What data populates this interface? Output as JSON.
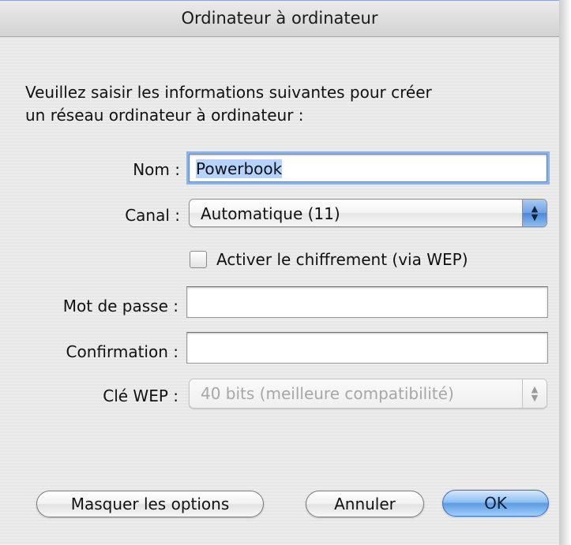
{
  "window": {
    "title": "Ordinateur à ordinateur"
  },
  "intro": {
    "line1": "Veuillez saisir les informations suivantes pour créer",
    "line2": "un réseau ordinateur à ordinateur :"
  },
  "form": {
    "name_label": "Nom :",
    "name_value": "Powerbook",
    "channel_label": "Canal :",
    "channel_value": "Automatique (11)",
    "encryption_label": "Activer le chiffrement (via WEP)",
    "encryption_checked": false,
    "password_label": "Mot de passe :",
    "password_value": "",
    "confirm_label": "Confirmation :",
    "confirm_value": "",
    "wep_label": "Clé WEP :",
    "wep_value": "40 bits (meilleure compatibilité)",
    "wep_enabled": false
  },
  "buttons": {
    "hide_options": "Masquer les options",
    "cancel": "Annuler",
    "ok": "OK"
  },
  "icons": {
    "popup_arrows": "up-down-arrows-icon",
    "checkbox": "checkbox-icon"
  },
  "colors": {
    "focus_ring": "#8db2e3",
    "default_button": "#5c9be3",
    "selection": "#b5d3ff"
  }
}
